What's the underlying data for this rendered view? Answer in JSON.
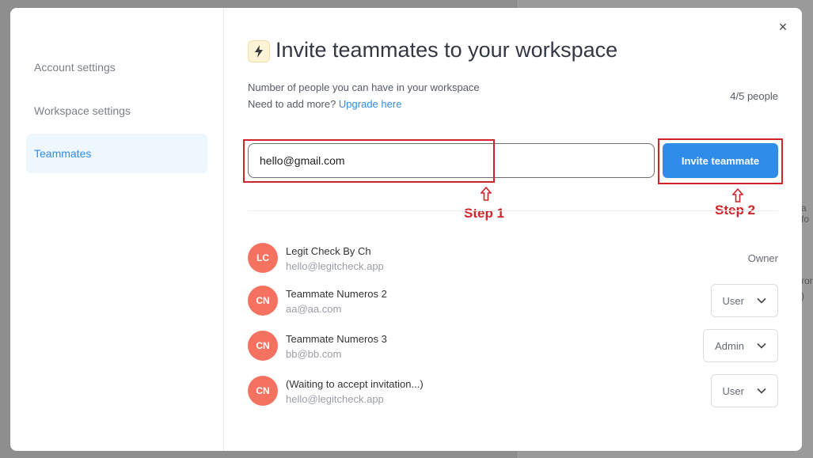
{
  "background": {
    "fragment_1": "a fo",
    "fragment_2": "ron",
    "fragment_3": ")"
  },
  "sidebar": {
    "items": [
      {
        "label": "Account settings",
        "active": false
      },
      {
        "label": "Workspace settings",
        "active": false
      },
      {
        "label": "Teammates",
        "active": true
      }
    ]
  },
  "header": {
    "close_symbol": "×",
    "icon": "lightning-icon",
    "title": "Invite teammates to your workspace"
  },
  "limits": {
    "description": "Number of people you can have in your workspace",
    "need_more_text": "Need to add more?",
    "upgrade_link": "Upgrade here",
    "count": "4/5 people"
  },
  "invite": {
    "email_value": "hello@gmail.com",
    "button_label": "Invite teammate"
  },
  "annotations": {
    "step1": "Step 1",
    "step2": "Step 2",
    "color": "#d1232a"
  },
  "members": [
    {
      "initials": "LC",
      "name": "Legit Check By Ch",
      "email": "hello@legitcheck.app",
      "role": "Owner",
      "editable": false
    },
    {
      "initials": "CN",
      "name": "Teammate Numeros 2",
      "email": "aa@aa.com",
      "role": "User",
      "editable": true
    },
    {
      "initials": "CN",
      "name": "Teammate Numeros 3",
      "email": "bb@bb.com",
      "role": "Admin",
      "editable": true
    },
    {
      "initials": "CN",
      "name": "(Waiting to accept invitation...)",
      "email": "hello@legitcheck.app",
      "role": "User",
      "editable": true
    }
  ],
  "colors": {
    "accent": "#2f8ce9",
    "avatar": "#f4725f",
    "active_bg": "#eef6fe"
  }
}
